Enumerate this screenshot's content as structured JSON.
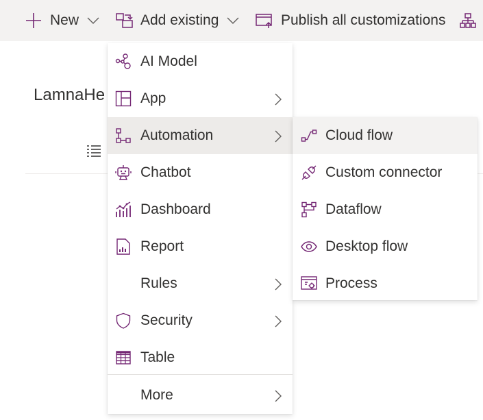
{
  "commandbar": {
    "new_label": "New",
    "add_existing_label": "Add existing",
    "publish_label": "Publish all customizations"
  },
  "page": {
    "title": "LamnaHe"
  },
  "add_menu": {
    "items": [
      {
        "label": "AI Model",
        "icon": "ai-model-icon"
      },
      {
        "label": "App",
        "icon": "app-icon",
        "submenu": true
      },
      {
        "label": "Automation",
        "icon": "automation-icon",
        "submenu": true,
        "active": true
      },
      {
        "label": "Chatbot",
        "icon": "chatbot-icon"
      },
      {
        "label": "Dashboard",
        "icon": "dashboard-icon"
      },
      {
        "label": "Report",
        "icon": "report-icon"
      },
      {
        "label": "Rules",
        "icon": "",
        "submenu": true
      },
      {
        "label": "Security",
        "icon": "shield-icon",
        "submenu": true
      },
      {
        "label": "Table",
        "icon": "table-icon"
      },
      {
        "label": "More",
        "icon": "",
        "submenu": true
      }
    ]
  },
  "automation_submenu": {
    "items": [
      {
        "label": "Cloud flow",
        "icon": "cloud-flow-icon",
        "hover": true
      },
      {
        "label": "Custom connector",
        "icon": "custom-connector-icon"
      },
      {
        "label": "Dataflow",
        "icon": "dataflow-icon"
      },
      {
        "label": "Desktop flow",
        "icon": "desktop-flow-icon"
      },
      {
        "label": "Process",
        "icon": "process-icon"
      }
    ]
  },
  "colors": {
    "accent": "#742774",
    "commandbar_bg": "#f3f2f1",
    "active_item_bg": "#edebe9",
    "hover_item_bg": "#f3f2f1",
    "text": "#323130"
  }
}
